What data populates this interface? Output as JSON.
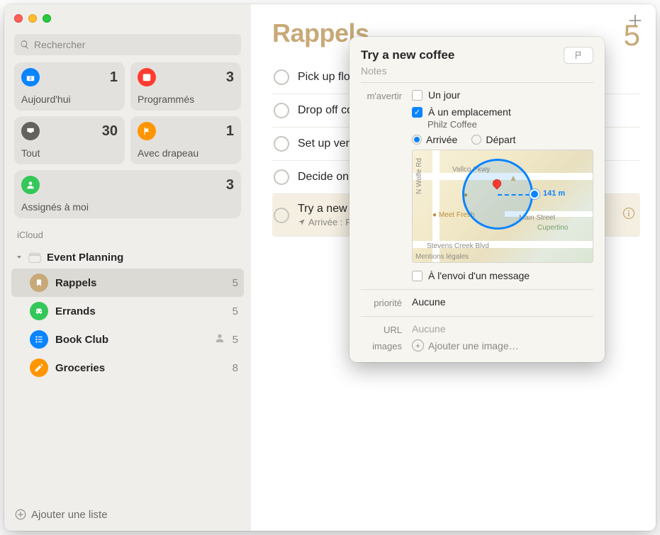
{
  "search": {
    "placeholder": "Rechercher"
  },
  "smart": {
    "today": {
      "label": "Aujourd'hui",
      "count": "1"
    },
    "scheduled": {
      "label": "Programmés",
      "count": "3"
    },
    "all": {
      "label": "Tout",
      "count": "30"
    },
    "flagged": {
      "label": "Avec drapeau",
      "count": "1"
    },
    "assigned": {
      "label": "Assignés à moi",
      "count": "3"
    }
  },
  "sidebar": {
    "section": "iCloud",
    "group": "Event Planning",
    "lists": [
      {
        "name": "Rappels",
        "count": "5",
        "icon": "tan",
        "selected": true
      },
      {
        "name": "Errands",
        "count": "5",
        "icon": "grn",
        "selected": false
      },
      {
        "name": "Book Club",
        "count": "5",
        "icon": "blu",
        "selected": false,
        "shared": true
      },
      {
        "name": "Groceries",
        "count": "8",
        "icon": "orng",
        "selected": false
      }
    ],
    "add": "Ajouter une liste"
  },
  "list": {
    "title": "Rappels",
    "count": "5",
    "items": [
      {
        "title": "Pick up flowers"
      },
      {
        "title": "Drop off contract"
      },
      {
        "title": "Set up venue walk through"
      },
      {
        "title": "Decide on invitation design"
      },
      {
        "title": "Try a new coffee",
        "sub_prefix": "Arrivée :",
        "sub_place": "Philz Coffee",
        "selected": true
      }
    ]
  },
  "popover": {
    "title": "Try a new coffee",
    "notes_placeholder": "Notes",
    "remind_label": "m'avertir",
    "on_day_label": "Un jour",
    "at_location_label": "À un emplacement",
    "at_location_checked": true,
    "location_value": "Philz Coffee",
    "arrive_label": "Arrivée",
    "leave_label": "Départ",
    "radio_selected": "arrive",
    "map": {
      "roads": [
        "Vallco Pkwy",
        "N Wolfe Rd",
        "Main Street",
        "Stevens Creek Blvd"
      ],
      "poi": [
        "Meet Fresh"
      ],
      "park": "Cupertino",
      "distance": "141 m",
      "legal": "Mentions légales"
    },
    "when_messaging_label": "À l'envoi d'un message",
    "priority_label": "priorité",
    "priority_value": "Aucune",
    "url_label": "URL",
    "url_placeholder": "Aucune",
    "images_label": "images",
    "add_image_label": "Ajouter une image…"
  }
}
